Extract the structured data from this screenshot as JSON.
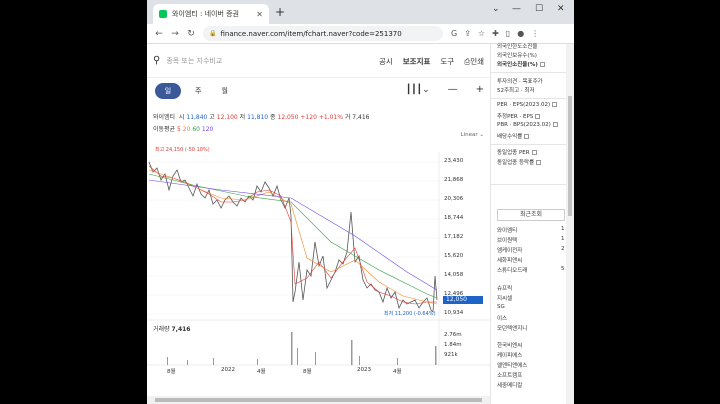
{
  "browser": {
    "tab_title": "와이엠티 : 네이버 증권",
    "new_tab": "+",
    "url": "finance.naver.com/item/fchart.naver?code=251370"
  },
  "search": {
    "placeholder": "종목 또는 지수비교",
    "menu": [
      "공시",
      "보조지표",
      "도구",
      "인쇄"
    ]
  },
  "periods": [
    "일",
    "주",
    "월"
  ],
  "quote": {
    "name": "와이엠티",
    "open_label": "시",
    "open": "11,840",
    "high_label": "고",
    "high": "12,100",
    "low_label": "저",
    "low": "11,810",
    "close_label": "종",
    "close": "12,050",
    "change": "+120",
    "pct": "+1.01%",
    "vol_label": "거",
    "vol": "7,416"
  },
  "ma": {
    "label": "이동평균",
    "p5": "5",
    "p20": "20",
    "p60": "60",
    "p120": "120"
  },
  "scale_label": "Linear",
  "max_label": "최고 24,150 (-50.10%)",
  "min_label": "최저 11,200 (-0.64%)",
  "price_axis": [
    "23,430",
    "21,868",
    "20,306",
    "18,744",
    "17,182",
    "15,620",
    "14,058",
    "12,496",
    "10,934"
  ],
  "current_price": "12,050",
  "volume": {
    "title": "거래량",
    "value": "7,416",
    "axis": [
      "2.76m",
      "1.84m",
      "921k"
    ]
  },
  "x_axis": [
    "8월",
    "2022",
    "4월",
    "8월",
    "2023",
    "4월"
  ],
  "side": {
    "top_items": [
      "외국인한도소진율",
      "외국인보유수(%)",
      "외국인소진율(%)"
    ],
    "mid_items": [
      "투자의견 · 목표주가",
      "52주최고 · 최저"
    ],
    "items2": [
      "PER · EPS(2023.02)",
      "추정PER · EPS",
      "PBR · BPS(2023.02)",
      "배당수익률"
    ],
    "items3": [
      "동일업종 PER",
      "동일업종 등락률"
    ],
    "recent_header": "최근조회",
    "recent": [
      {
        "name": "와이엠티",
        "n": "1"
      },
      {
        "name": "브이원텍",
        "n": "1"
      },
      {
        "name": "엠케이전자",
        "n": "2"
      },
      {
        "name": "세화피앤씨",
        "n": ""
      },
      {
        "name": "스튜디오드래",
        "n": "5"
      }
    ],
    "list2": [
      "슈프릭",
      "지씨셀",
      "SG",
      "이스",
      "모던텍앤지니"
    ],
    "list3": [
      "한국비엔씨",
      "케이피에스",
      "엘앤티엔에스",
      "소프트캠프",
      "세중메디칼"
    ]
  }
}
